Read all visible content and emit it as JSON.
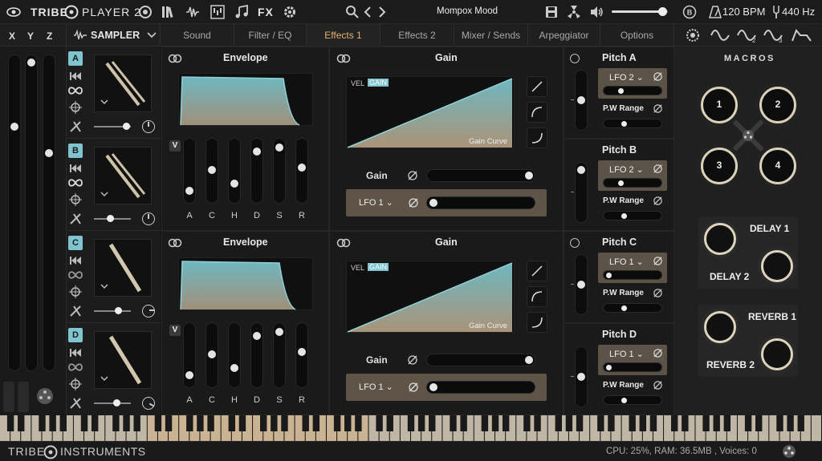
{
  "topbar": {
    "brand": "TRIBE",
    "product": "PLAYER 2",
    "fx_label": "FX",
    "preset_name": "Mompox Mood",
    "bpm": "120 BPM",
    "tuning": "440 Hz",
    "volume_level": 0.9
  },
  "xyz": {
    "x": "X",
    "y": "Y",
    "z": "Z"
  },
  "sampler": {
    "title": "SAMPLER",
    "slots": [
      "A",
      "B",
      "C",
      "D"
    ]
  },
  "tabs": [
    "Sound",
    "Filter / EQ",
    "Effects 1",
    "Effects 2",
    "Mixer / Sends",
    "Arpeggiator",
    "Options"
  ],
  "active_tab": "Effects 1",
  "envelope": {
    "title": "Envelope",
    "v_label": "V",
    "params": [
      "A",
      "C",
      "H",
      "D",
      "S",
      "R"
    ]
  },
  "gain": {
    "title": "Gain",
    "vel": "VEL",
    "gain_tag": "GAIN",
    "curve_label": "Gain Curve",
    "gain_label": "Gain",
    "lfo_label": "LFO 1 ⌄"
  },
  "pitch": {
    "items": [
      {
        "title": "Pitch A",
        "lfo": "LFO 2 ⌄",
        "pw": "P.W Range"
      },
      {
        "title": "Pitch B",
        "lfo": "LFO 2 ⌄",
        "pw": "P.W Range"
      },
      {
        "title": "Pitch C",
        "lfo": "LFO 1 ⌄",
        "pw": "P.W Range"
      },
      {
        "title": "Pitch D",
        "lfo": "LFO 1 ⌄",
        "pw": "P.W Range"
      }
    ]
  },
  "macros": {
    "title": "MACROS",
    "knobs": [
      "1",
      "2",
      "3",
      "4"
    ],
    "delay1": "DELAY 1",
    "delay2": "DELAY 2",
    "reverb1": "REVERB 1",
    "reverb2": "REVERB 2"
  },
  "footer": {
    "brand": "TRIBE",
    "brand2": "INSTRUMENTS",
    "status": "CPU: 25%, RAM: 36.5MB , Voices: 0"
  },
  "colors": {
    "accent_teal": "#7fc4cf",
    "accent_gold": "#e0b26a",
    "panel_bg": "#1a1a1a",
    "lfo_box": "#5e5447"
  }
}
